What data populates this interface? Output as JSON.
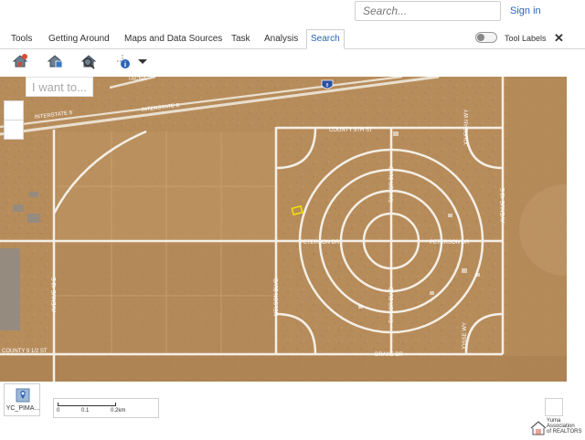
{
  "header": {
    "search_placeholder": "Search...",
    "signin_label": "Sign in"
  },
  "tabs": [
    {
      "label": "Tools"
    },
    {
      "label": "Getting Around"
    },
    {
      "label": "Maps and Data Sources"
    },
    {
      "label": "Task"
    },
    {
      "label": "Analysis"
    },
    {
      "label": "Search"
    }
  ],
  "active_tab": "Search",
  "toolbar": {
    "tool_labels_text": "Tool Labels",
    "close_glyph": "✕"
  },
  "map": {
    "iwant_placeholder": "I want to...",
    "labels": {
      "tacna": "TACNA",
      "interstate_left": "INTERSTATE 8",
      "interstate_right": "INTERSTATE 8",
      "interstate_shield": "8",
      "county_9th": "COUNTY 9TH ST",
      "county_9_half": "COUNTY 9 1/2 ST",
      "peterson_left": "PETERSON DR",
      "peterson_right": "PETERSON DR",
      "taylor_top": "TAYLOR BLVD",
      "taylor_bottom": "TAYLOR BLVD",
      "nelson": "NELSON BLVD",
      "drake": "DRAKE DR",
      "avenue_42e": "AVENUE 42 E",
      "avenue_43e": "AVENUE 43 E",
      "jordan_top": "JOURDAN WY",
      "jordan_bottom": "JOSSE WY"
    }
  },
  "bottom": {
    "layer_label": "YC_PIMA...",
    "scale_ticks": [
      "0",
      "0.1",
      "0.2km"
    ],
    "logo_line1": "Yuma",
    "logo_line2": "Association",
    "logo_line3": "of REALTORS"
  },
  "colors": {
    "accent": "#2a64b8",
    "desert": "#b78c5b",
    "road": "#f4efe6"
  }
}
